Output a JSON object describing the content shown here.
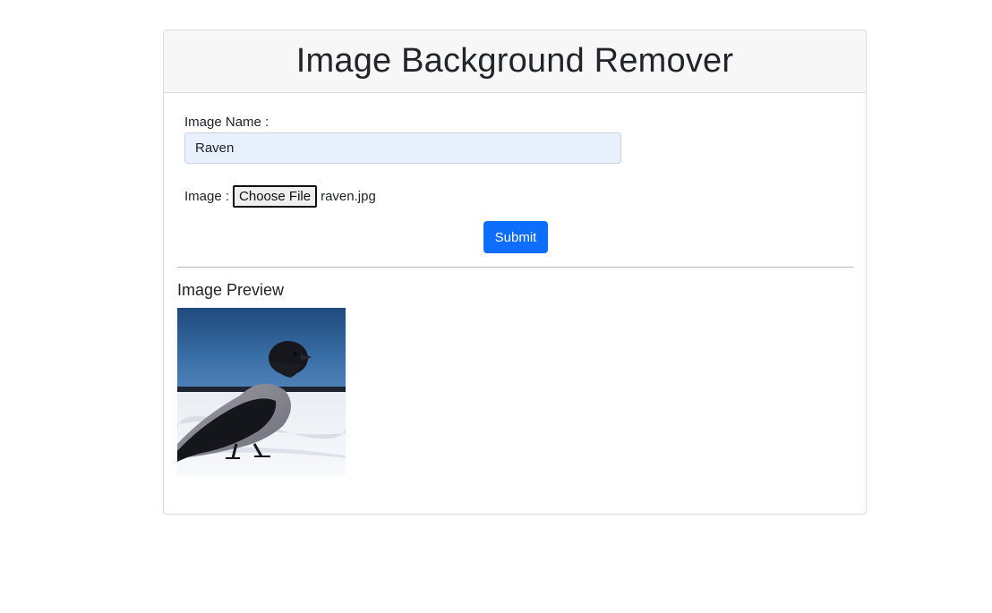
{
  "header": {
    "title": "Image Background Remover"
  },
  "form": {
    "name_label": "Image Name :",
    "name_value": "Raven",
    "image_label": "Image :",
    "choose_file_label": "Choose File",
    "selected_file": "raven.jpg",
    "submit_label": "Submit"
  },
  "preview": {
    "title": "Image Preview"
  },
  "colors": {
    "primary": "#0d6efd",
    "header_bg": "#f7f7f7",
    "autofill_bg": "#e8f0fe"
  }
}
